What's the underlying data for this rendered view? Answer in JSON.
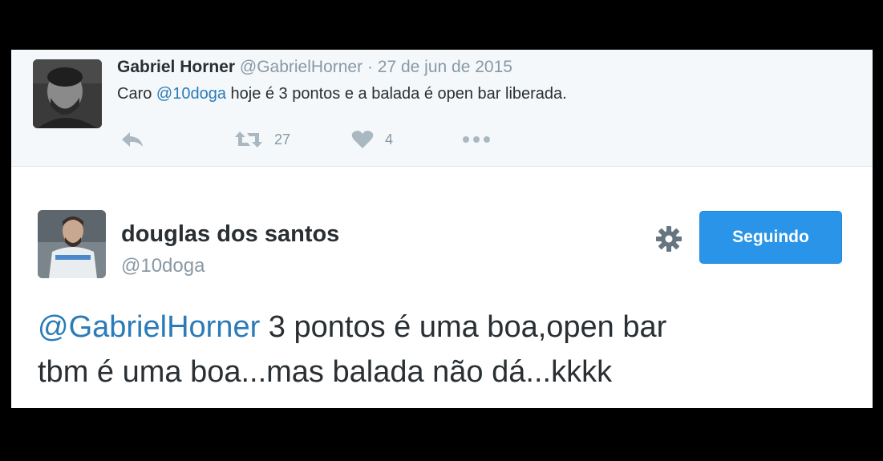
{
  "parent_tweet": {
    "author_name": "Gabriel Horner",
    "author_handle": "@GabrielHorner",
    "separator": "·",
    "date": "27 de jun de 2015",
    "text_prefix": "Caro ",
    "mention": "@10doga",
    "text_suffix": " hoje é 3 pontos e a balada é open bar liberada.",
    "retweet_count": "27",
    "like_count": "4",
    "icons": {
      "reply": "reply-arrow-icon",
      "retweet": "retweet-icon",
      "like": "heart-icon",
      "more": "more-dots-icon"
    }
  },
  "main_tweet": {
    "author_name": "douglas dos santos",
    "author_handle": "@10doga",
    "follow_button_label": "Seguindo",
    "mention": "@GabrielHorner",
    "text_line1_suffix": " 3 pontos é uma boa,open bar",
    "text_line2": "tbm é uma boa...mas balada não dá...kkkk",
    "icons": {
      "settings": "gear-icon"
    }
  },
  "colors": {
    "link": "#2b7bb9",
    "follow_button": "#2a95e8",
    "muted": "#8899a6",
    "icon": "#aab8c2",
    "parent_background": "#f5f8fa"
  }
}
